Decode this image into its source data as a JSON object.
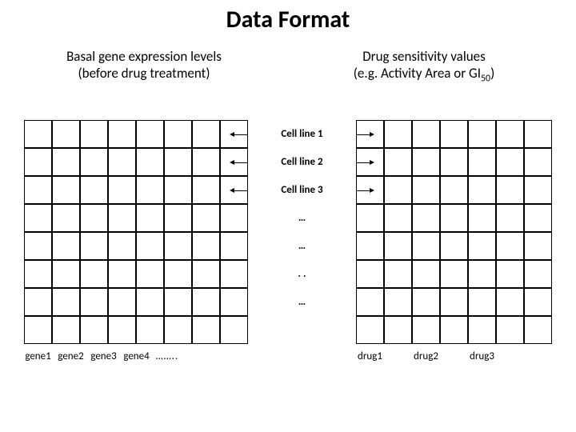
{
  "title": "Data Format",
  "left_caption": {
    "line1": "Basal gene expression levels",
    "line2": "(before drug treatment)"
  },
  "right_caption": {
    "line1": "Drug sensitivity values",
    "line2_prefix": "(e.g. Activity Area or GI",
    "line2_sub": "50",
    "line2_suffix": ")"
  },
  "row_labels": [
    "Cell line 1",
    "Cell line 2",
    "Cell line 3",
    "…",
    "…",
    ". .",
    "…"
  ],
  "gene_axis": [
    "gene1",
    "gene2",
    "gene3",
    "gene4",
    "…….."
  ],
  "drug_axis": [
    "drug1",
    "drug2",
    "drug3"
  ],
  "grids": {
    "left_cols": 8,
    "left_rows": 8,
    "right_cols": 7,
    "right_rows": 8
  }
}
